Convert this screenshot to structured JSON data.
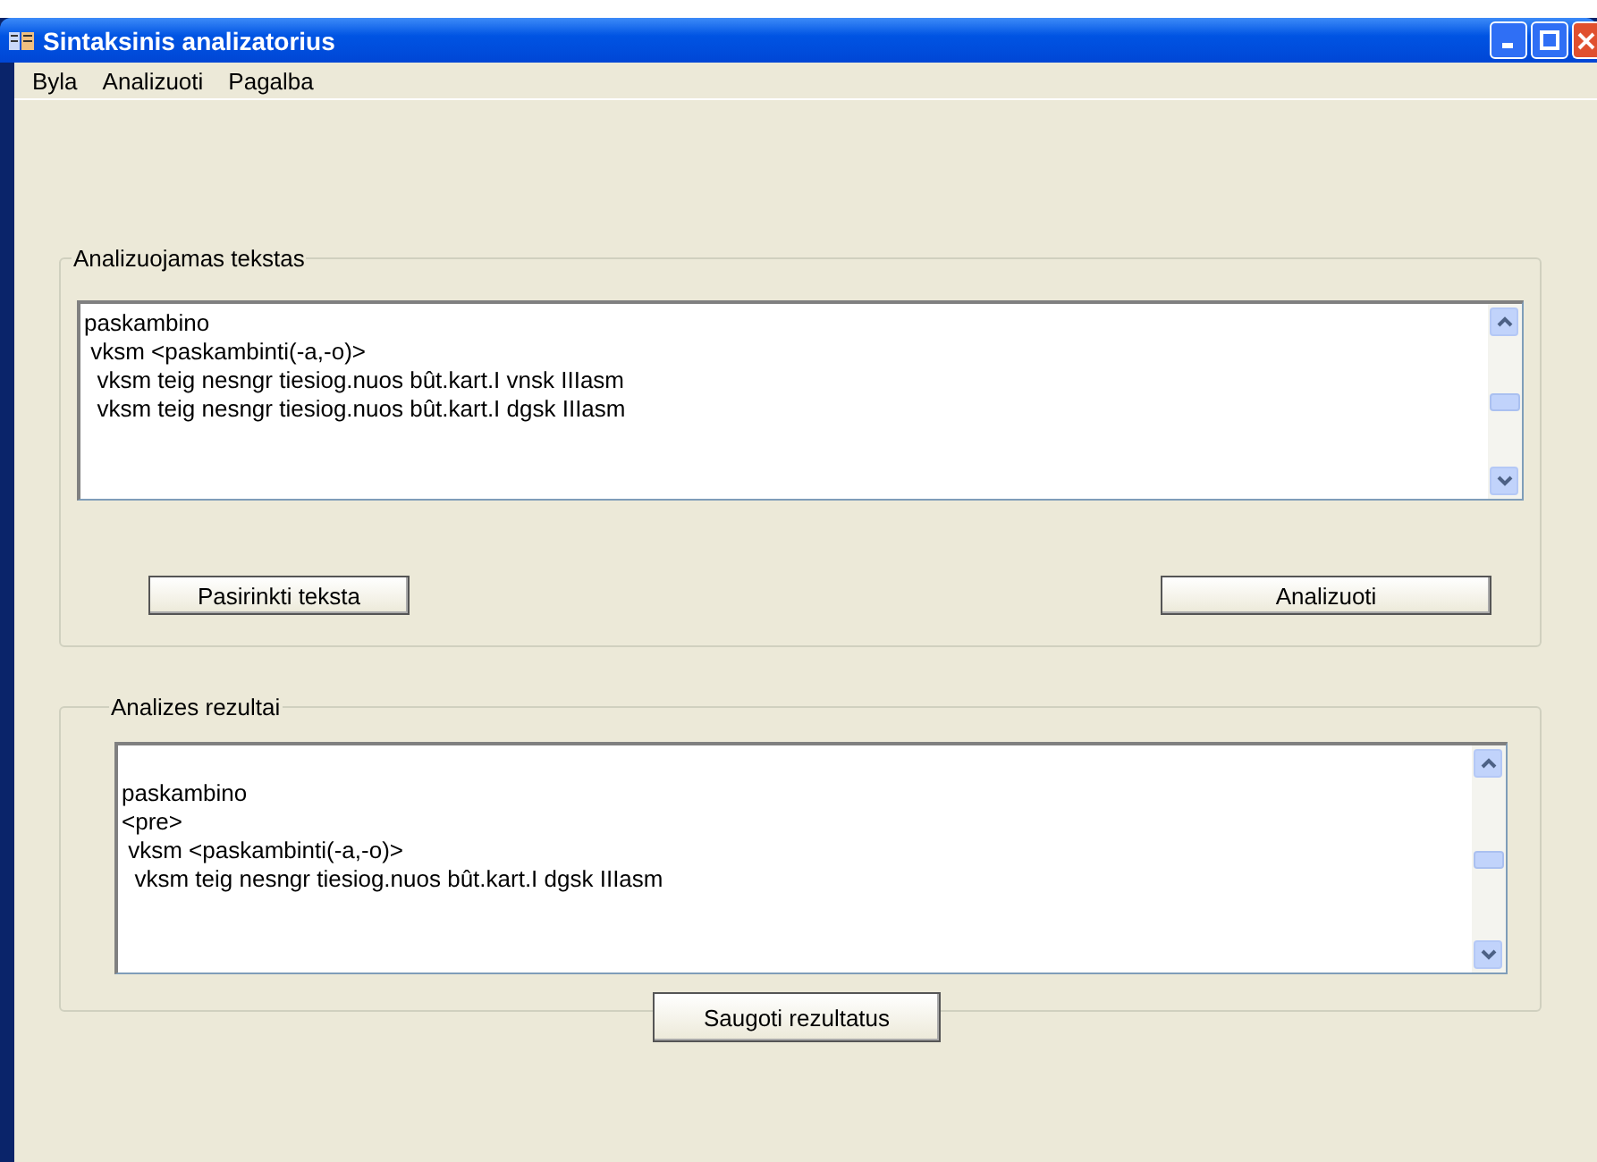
{
  "window": {
    "title": "Sintaksinis analizatorius"
  },
  "menu": [
    "Byla",
    "Analizuoti",
    "Pagalba"
  ],
  "input_group": {
    "title": "Analizuojamas tekstas",
    "lines": [
      "paskambino",
      " vksm <paskambinti(-a,-o)>",
      "  vksm teig nesngr tiesiog.nuos bût.kart.I vnsk IIIasm",
      "  vksm teig nesngr tiesiog.nuos bût.kart.I dgsk IIIasm"
    ],
    "buttons": [
      "Pasirinkti teksta",
      "Analizuoti"
    ]
  },
  "result_group": {
    "title": "Analizes rezultai",
    "lines": [
      "paskambino",
      "<pre>",
      " vksm <paskambinti(-a,-o)>",
      "  vksm teig nesngr tiesiog.nuos bût.kart.I dgsk IIIasm"
    ],
    "buttons": [
      "Saugoti rezultatus"
    ]
  }
}
